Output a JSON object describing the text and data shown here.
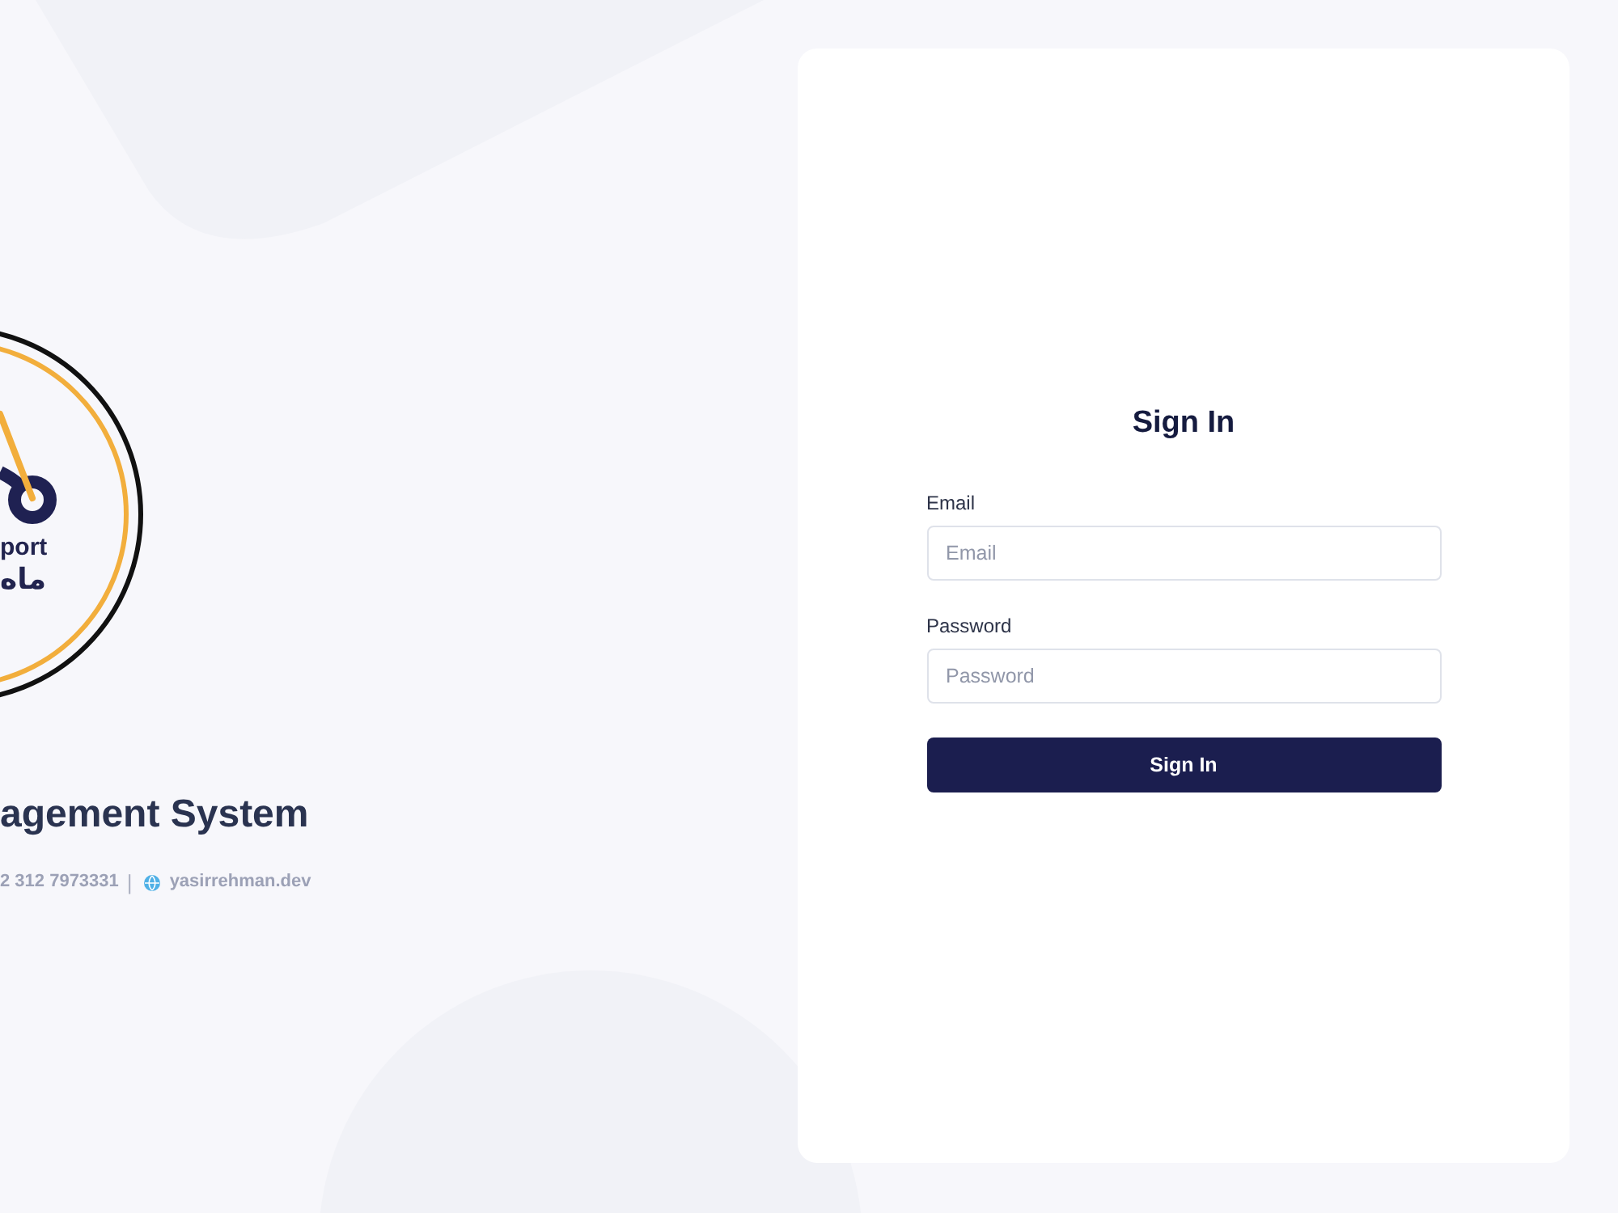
{
  "brand": {
    "logo": {
      "latin_text": "port",
      "arabic_text": "ماه"
    },
    "title": "agement System",
    "contact": {
      "phone": "2 312 7973331",
      "separator": "|",
      "website": "yasirrehman.dev"
    }
  },
  "sign_in": {
    "title": "Sign In",
    "fields": [
      {
        "label": "Email",
        "placeholder": "Email"
      },
      {
        "label": "Password",
        "placeholder": "Password"
      }
    ],
    "button": "Sign In"
  }
}
